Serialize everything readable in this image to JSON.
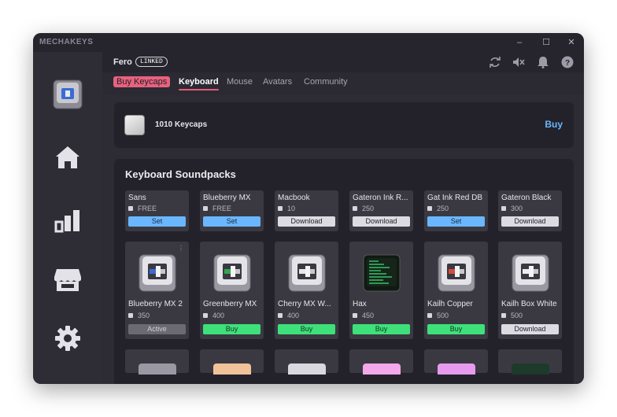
{
  "app": {
    "name": "MECHAKEYS"
  },
  "window_controls": {
    "minimize": "–",
    "maximize": "☐",
    "close": "✕"
  },
  "user": {
    "name": "Fero",
    "status_badge": "LINKED"
  },
  "tabs": [
    {
      "label": "Buy Keycaps"
    },
    {
      "label": "Keyboard"
    },
    {
      "label": "Mouse"
    },
    {
      "label": "Avatars"
    },
    {
      "label": "Community"
    }
  ],
  "keycaps_banner": {
    "label": "1010 Keycaps",
    "buy_label": "Buy"
  },
  "soundpacks": {
    "title": "Keyboard Soundpacks",
    "row1": [
      {
        "name": "Sans",
        "price": "FREE",
        "action": "Set"
      },
      {
        "name": "Blueberry MX",
        "price": "FREE",
        "action": "Set"
      },
      {
        "name": "Macbook",
        "price": "10",
        "action": "Download"
      },
      {
        "name": "Gateron Ink R...",
        "price": "250",
        "action": "Download"
      },
      {
        "name": "Gat Ink Red DB",
        "price": "250",
        "action": "Set"
      },
      {
        "name": "Gateron Black",
        "price": "300",
        "action": "Download"
      }
    ],
    "row2": [
      {
        "name": "Blueberry MX 2",
        "price": "350",
        "action": "Active",
        "accent": "#3a6bd6",
        "icon": "blueberry-switch-keycap-icon"
      },
      {
        "name": "Greenberry MX",
        "price": "400",
        "action": "Buy",
        "accent": "#2fa84f",
        "icon": "greenberry-switch-keycap-icon"
      },
      {
        "name": "Cherry MX W...",
        "price": "400",
        "action": "Buy",
        "accent": "#e8e8e8",
        "icon": "cherry-white-switch-keycap-icon"
      },
      {
        "name": "Hax",
        "price": "450",
        "action": "Buy",
        "accent": "#3ee07a",
        "icon": "hax-terminal-keycap-icon"
      },
      {
        "name": "Kailh Copper",
        "price": "500",
        "action": "Buy",
        "accent": "#d84a3a",
        "icon": "kailh-copper-switch-keycap-icon"
      },
      {
        "name": "Kailh Box White",
        "price": "500",
        "action": "Download",
        "accent": "#eeeeee",
        "icon": "kailh-box-white-switch-keycap-icon"
      }
    ],
    "row3_colors": [
      "#9a99a3",
      "#f0c39a",
      "#d8d8de",
      "#f2a8ea",
      "#e79bee",
      "#1d3a2a"
    ]
  },
  "colors": {
    "accent_pink": "#e8627f",
    "set_blue": "#6ab7ff",
    "buy_green": "#3ee07a"
  }
}
